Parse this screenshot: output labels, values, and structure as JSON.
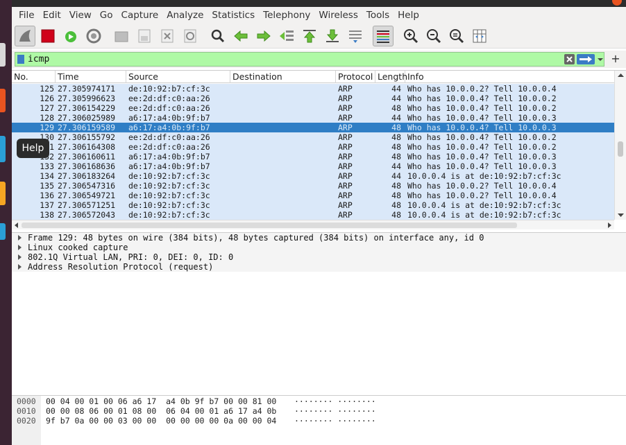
{
  "menu": [
    "File",
    "Edit",
    "View",
    "Go",
    "Capture",
    "Analyze",
    "Statistics",
    "Telephony",
    "Wireless",
    "Tools",
    "Help"
  ],
  "tooltip": "Help",
  "filter": {
    "value": "icmp"
  },
  "columns": [
    "No.",
    "Time",
    "Source",
    "Destination",
    "Protocol",
    "Length",
    "Info"
  ],
  "packets": [
    {
      "no": "125",
      "time": "27.305974171",
      "src": "de:10:92:b7:cf:3c",
      "dst": "",
      "proto": "ARP",
      "len": "44",
      "info": "Who has 10.0.0.2? Tell 10.0.0.4"
    },
    {
      "no": "126",
      "time": "27.305996623",
      "src": "ee:2d:df:c0:aa:26",
      "dst": "",
      "proto": "ARP",
      "len": "44",
      "info": "Who has 10.0.0.4? Tell 10.0.0.2"
    },
    {
      "no": "127",
      "time": "27.306154229",
      "src": "ee:2d:df:c0:aa:26",
      "dst": "",
      "proto": "ARP",
      "len": "48",
      "info": "Who has 10.0.0.4? Tell 10.0.0.2"
    },
    {
      "no": "128",
      "time": "27.306025989",
      "src": "a6:17:a4:0b:9f:b7",
      "dst": "",
      "proto": "ARP",
      "len": "44",
      "info": "Who has 10.0.0.4? Tell 10.0.0.3"
    },
    {
      "no": "129",
      "time": "27.306159589",
      "src": "a6:17:a4:0b:9f:b7",
      "dst": "",
      "proto": "ARP",
      "len": "48",
      "info": "Who has 10.0.0.4? Tell 10.0.0.3",
      "selected": true
    },
    {
      "no": "130",
      "time": "27.306155792",
      "src": "ee:2d:df:c0:aa:26",
      "dst": "",
      "proto": "ARP",
      "len": "48",
      "info": "Who has 10.0.0.4? Tell 10.0.0.2"
    },
    {
      "no": "131",
      "time": "27.306164308",
      "src": "ee:2d:df:c0:aa:26",
      "dst": "",
      "proto": "ARP",
      "len": "48",
      "info": "Who has 10.0.0.4? Tell 10.0.0.2"
    },
    {
      "no": "132",
      "time": "27.306160611",
      "src": "a6:17:a4:0b:9f:b7",
      "dst": "",
      "proto": "ARP",
      "len": "48",
      "info": "Who has 10.0.0.4? Tell 10.0.0.3"
    },
    {
      "no": "133",
      "time": "27.306168636",
      "src": "a6:17:a4:0b:9f:b7",
      "dst": "",
      "proto": "ARP",
      "len": "44",
      "info": "Who has 10.0.0.4? Tell 10.0.0.3"
    },
    {
      "no": "134",
      "time": "27.306183264",
      "src": "de:10:92:b7:cf:3c",
      "dst": "",
      "proto": "ARP",
      "len": "44",
      "info": "10.0.0.4 is at de:10:92:b7:cf:3c"
    },
    {
      "no": "135",
      "time": "27.306547316",
      "src": "de:10:92:b7:cf:3c",
      "dst": "",
      "proto": "ARP",
      "len": "48",
      "info": "Who has 10.0.0.2? Tell 10.0.0.4"
    },
    {
      "no": "136",
      "time": "27.306549721",
      "src": "de:10:92:b7:cf:3c",
      "dst": "",
      "proto": "ARP",
      "len": "48",
      "info": "Who has 10.0.0.2? Tell 10.0.0.4"
    },
    {
      "no": "137",
      "time": "27.306571251",
      "src": "de:10:92:b7:cf:3c",
      "dst": "",
      "proto": "ARP",
      "len": "48",
      "info": "10.0.0.4 is at de:10:92:b7:cf:3c"
    },
    {
      "no": "138",
      "time": "27.306572043",
      "src": "de:10:92:b7:cf:3c",
      "dst": "",
      "proto": "ARP",
      "len": "48",
      "info": "10.0.0.4 is at de:10:92:b7:cf:3c"
    }
  ],
  "details": [
    "Frame 129: 48 bytes on wire (384 bits), 48 bytes captured (384 bits) on interface any, id 0",
    "Linux cooked capture",
    "802.1Q Virtual LAN, PRI: 0, DEI: 0, ID: 0",
    "Address Resolution Protocol (request)"
  ],
  "bytes": [
    {
      "offset": "0000",
      "hex": "00 04 00 01 00 06 a6 17  a4 0b 9f b7 00 00 81 00",
      "ascii": "········ ········"
    },
    {
      "offset": "0010",
      "hex": "00 00 08 06 00 01 08 00  06 04 00 01 a6 17 a4 0b",
      "ascii": "········ ········"
    },
    {
      "offset": "0020",
      "hex": "9f b7 0a 00 00 03 00 00  00 00 00 00 0a 00 00 04",
      "ascii": "········ ········"
    }
  ]
}
